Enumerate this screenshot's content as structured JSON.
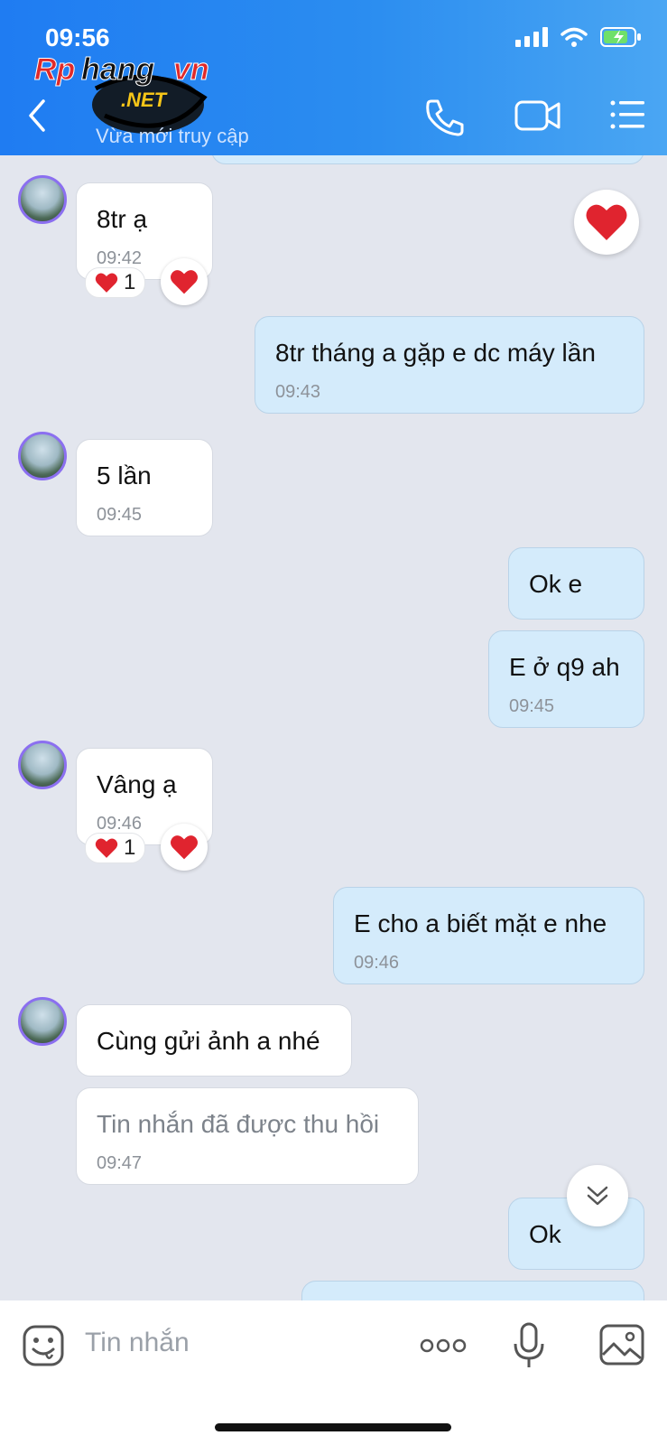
{
  "status_bar": {
    "time": "09:56"
  },
  "header": {
    "watermark_text": "Rphangvn",
    "watermark_sub": ".NET",
    "subtitle": "Vừa mới truy cập",
    "icons": [
      "back-icon",
      "phone-icon",
      "video-icon",
      "menu-icon"
    ]
  },
  "messages": [
    {
      "side": "in",
      "text": "8tr ạ",
      "time": "09:42",
      "reaction_count": "1"
    },
    {
      "side": "out",
      "text": "8tr tháng a gặp e dc máy lần",
      "time": "09:43"
    },
    {
      "side": "in",
      "text": "5 lần",
      "time": "09:45"
    },
    {
      "side": "out",
      "text": "Ok e",
      "time": ""
    },
    {
      "side": "out",
      "text": "E ở q9 ah",
      "time": "09:45"
    },
    {
      "side": "in",
      "text": "Vâng ạ",
      "time": "09:46",
      "reaction_count": "1"
    },
    {
      "side": "out",
      "text": "E cho a biết mặt e nhe",
      "time": "09:46"
    },
    {
      "side": "in",
      "text": "Cùng gửi ảnh a nhé",
      "time": ""
    },
    {
      "side": "in",
      "text": "Tin nhắn đã được thu hồi",
      "time": "09:47",
      "recalled": true
    },
    {
      "side": "out",
      "text": "Ok",
      "time": ""
    }
  ],
  "input": {
    "placeholder": "Tin nhắn"
  },
  "colors": {
    "header": "#2b8df0",
    "outgoing": "#d4ebfb",
    "incoming": "#ffffff",
    "heart": "#e0242f",
    "background": "#e3e6ee"
  }
}
